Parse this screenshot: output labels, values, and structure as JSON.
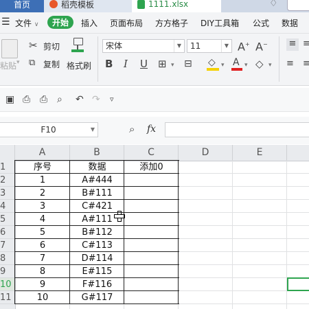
{
  "tabs": {
    "home": "首页",
    "template": "稻壳模板",
    "file": "1111.xlsx"
  },
  "menu": {
    "file": "文件",
    "items": [
      "开始",
      "插入",
      "页面布局",
      "方方格子",
      "DIY工具箱",
      "公式",
      "数据"
    ]
  },
  "ribbon": {
    "paste": "粘贴",
    "cut": "剪切",
    "copy": "复制",
    "format_painter": "格式刷",
    "font_name": "宋体",
    "font_size": "11"
  },
  "formula_bar": {
    "name_box": "F10",
    "fx": "fx",
    "value": ""
  },
  "columns": [
    "A",
    "B",
    "C",
    "D",
    "E"
  ],
  "rows": [
    "1",
    "2",
    "3",
    "4",
    "5",
    "6",
    "7",
    "8",
    "9",
    "10",
    "11"
  ],
  "table": {
    "headers": [
      "序号",
      "数据",
      "添加0"
    ],
    "data": [
      [
        "1",
        "A#444"
      ],
      [
        "2",
        "B#111"
      ],
      [
        "3",
        "C#421"
      ],
      [
        "4",
        "A#111"
      ],
      [
        "5",
        "B#112"
      ],
      [
        "6",
        "C#113"
      ],
      [
        "7",
        "D#114"
      ],
      [
        "8",
        "E#115"
      ],
      [
        "9",
        "F#116"
      ],
      [
        "10",
        "G#117"
      ]
    ]
  },
  "colors": {
    "accent_green": "#2ea44f",
    "home_tab": "#3d6fb6",
    "fill_yellow": "#f5d100",
    "font_red": "#e02020"
  }
}
